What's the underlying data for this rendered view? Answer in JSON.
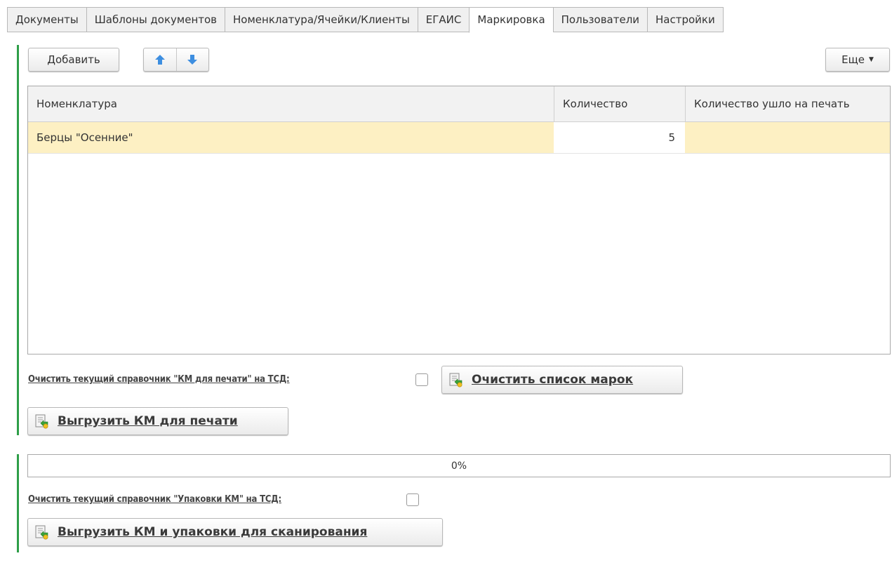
{
  "tabs": [
    "Документы",
    "Шаблоны документов",
    "Номенклатура/Ячейки/Клиенты",
    "ЕГАИС",
    "Маркировка",
    "Пользователи",
    "Настройки"
  ],
  "toolbar": {
    "add_label": "Добавить",
    "more_label": "Еще"
  },
  "table": {
    "columns": [
      "Номенклатура",
      "Количество",
      "Количество ушло на печать"
    ],
    "rows": [
      {
        "name": "Берцы \"Осенние\"",
        "qty": "5",
        "printed": ""
      }
    ]
  },
  "print_section": {
    "clear_label": "Очистить текущий справочник  \"КМ для печати\" на ТСД:",
    "clear_checked": false,
    "clear_marks_button": "Очистить список марок",
    "export_button": "Выгрузить КМ для печати"
  },
  "scan_section": {
    "progress_text": "0%",
    "progress_value": 0,
    "clear_label": "Очистить текущий справочник  \"Упаковки КМ\" на ТСД:",
    "clear_checked": false,
    "export_button": "Выгрузить КМ и упаковки для сканирования"
  },
  "colors": {
    "accent_bar": "#2e9e48",
    "selected_row": "#fdf0c3",
    "arrow": "#3d8ee0"
  },
  "icons": {
    "up": "arrow-up-icon",
    "down": "arrow-down-icon",
    "export": "document-export-icon"
  }
}
